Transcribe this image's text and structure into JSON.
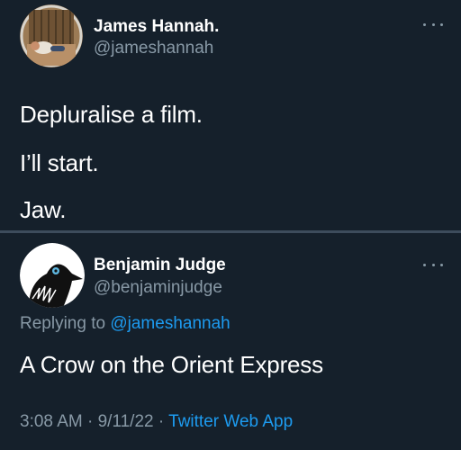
{
  "tweet": {
    "display_name": "James Hannah.",
    "handle": "@jameshannah",
    "lines": [
      "Depluralise a film.",
      "I’ll start.",
      "Jaw."
    ]
  },
  "reply": {
    "display_name": "Benjamin Judge",
    "handle": "@benjaminjudge",
    "replying_to_prefix": "Replying to ",
    "replying_to_handle": "@jameshannah",
    "text": "A Crow on the Orient Express",
    "time": "3:08 AM",
    "separator": " · ",
    "date": "9/11/22",
    "source": "Twitter Web App"
  },
  "colors": {
    "background": "#15202b",
    "secondary_text": "#8899a6",
    "link": "#1d9bf0",
    "divider": "#3d4c5c"
  },
  "icons": [
    "more-options-icon"
  ]
}
